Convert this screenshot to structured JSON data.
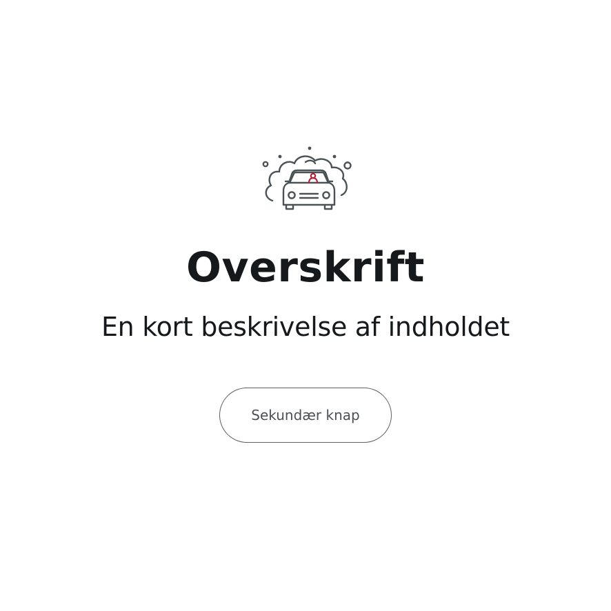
{
  "empty_state": {
    "icon": "car-wash-icon",
    "title": "Overskrift",
    "description": "En kort beskrivelse af indholdet",
    "secondary_button_label": "Sekundær knap"
  },
  "colors": {
    "text": "#15191b",
    "icon_stroke": "#4a5256",
    "icon_accent": "#b0213a",
    "button_border": "#595f62",
    "background": "#ffffff"
  }
}
